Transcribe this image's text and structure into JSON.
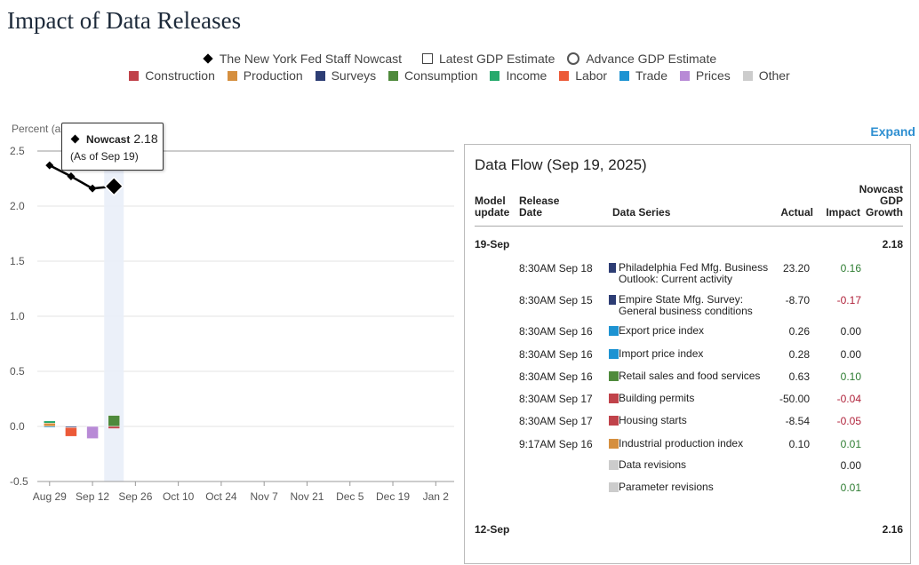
{
  "page": {
    "title": "Impact of Data Releases"
  },
  "legend": {
    "markers": [
      {
        "label": "The New York Fed Staff Nowcast",
        "icon": "filled-diamond-icon"
      },
      {
        "label": "Latest GDP Estimate",
        "icon": "open-square-icon"
      },
      {
        "label": "Advance GDP Estimate",
        "icon": "open-circle-icon"
      }
    ],
    "categories": [
      {
        "label": "Construction",
        "color": "#c0424a"
      },
      {
        "label": "Production",
        "color": "#d58f3f"
      },
      {
        "label": "Surveys",
        "color": "#2d3d74"
      },
      {
        "label": "Consumption",
        "color": "#4f8a3c"
      },
      {
        "label": "Income",
        "color": "#26a96c"
      },
      {
        "label": "Labor",
        "color": "#ec5a38"
      },
      {
        "label": "Trade",
        "color": "#1d93d2"
      },
      {
        "label": "Prices",
        "color": "#b88ad6"
      },
      {
        "label": "Other",
        "color": "#cccccc"
      }
    ]
  },
  "chart_data": {
    "type": "line",
    "ylabel": "Percent (annual rate)",
    "ylim": [
      -0.5,
      2.5
    ],
    "yticks": [
      "2.5",
      "2.0",
      "1.5",
      "1.0",
      "0.5",
      "0.0",
      "-0.5"
    ],
    "yticks_values": [
      2.5,
      2.0,
      1.5,
      1.0,
      0.5,
      0.0,
      -0.5
    ],
    "xlim": [
      "2025-08-25",
      "2026-01-08"
    ],
    "xticks": [
      {
        "label": "Aug 29",
        "date": "2025-08-29"
      },
      {
        "label": "Sep 12",
        "date": "2025-09-12"
      },
      {
        "label": "Sep 26",
        "date": "2025-09-26"
      },
      {
        "label": "Oct 10",
        "date": "2025-10-10"
      },
      {
        "label": "Oct 24",
        "date": "2025-10-24"
      },
      {
        "label": "Nov 7",
        "date": "2025-11-07"
      },
      {
        "label": "Nov 21",
        "date": "2025-11-21"
      },
      {
        "label": "Dec 5",
        "date": "2025-12-05"
      },
      {
        "label": "Dec 19",
        "date": "2025-12-19"
      },
      {
        "label": "Jan 2",
        "date": "2026-01-02"
      }
    ],
    "series": [
      {
        "name": "The New York Fed Staff Nowcast",
        "x": [
          "2025-08-29",
          "2025-09-05",
          "2025-09-12",
          "2025-09-19"
        ],
        "values": [
          2.37,
          2.27,
          2.16,
          2.18
        ]
      }
    ],
    "impact_bars": [
      {
        "date": "2025-08-29",
        "segments": [
          {
            "category": "Production",
            "value": 0.03
          },
          {
            "category": "Income",
            "value": 0.02
          },
          {
            "category": "Trade",
            "value": -0.01
          }
        ]
      },
      {
        "date": "2025-09-05",
        "segments": [
          {
            "category": "Surveys",
            "value": -0.01
          },
          {
            "category": "Labor",
            "value": -0.08
          }
        ]
      },
      {
        "date": "2025-09-12",
        "segments": [
          {
            "category": "Prices",
            "value": -0.11
          }
        ]
      },
      {
        "date": "2025-09-19",
        "segments": [
          {
            "category": "Consumption",
            "value": 0.1
          },
          {
            "category": "Construction",
            "value": -0.02
          }
        ]
      }
    ],
    "highlight_date": "2025-09-19",
    "grid": true
  },
  "tooltip": {
    "label": "Nowcast",
    "value": "2.18",
    "as_of": "(As of Sep 19)"
  },
  "expand_label": "Expand",
  "panel": {
    "title": "Data Flow (Sep 19, 2025)",
    "headers": {
      "model_update": "Model update",
      "release_date": "Release Date",
      "data_series": "Data Series",
      "actual": "Actual",
      "impact": "Impact",
      "nowcast": "Nowcast GDP Growth"
    },
    "update1": {
      "date": "19-Sep",
      "growth": "2.18"
    },
    "rows": [
      {
        "time": "8:30AM Sep 18",
        "series": "Philadelphia Fed Mfg. Business Outlook: Current activity",
        "color": "#2d3d74",
        "actual": "23.20",
        "impact": "0.16",
        "sign": "pos"
      },
      {
        "time": "8:30AM Sep 15",
        "series": "Empire State Mfg. Survey: General business conditions",
        "color": "#2d3d74",
        "actual": "-8.70",
        "impact": "-0.17",
        "sign": "neg"
      },
      {
        "time": "8:30AM Sep 16",
        "series": "Export price index",
        "color": "#1d93d2",
        "actual": "0.26",
        "impact": "0.00",
        "sign": "neu"
      },
      {
        "time": "8:30AM Sep 16",
        "series": "Import price index",
        "color": "#1d93d2",
        "actual": "0.28",
        "impact": "0.00",
        "sign": "neu"
      },
      {
        "time": "8:30AM Sep 16",
        "series": "Retail sales and food services",
        "color": "#4f8a3c",
        "actual": "0.63",
        "impact": "0.10",
        "sign": "pos"
      },
      {
        "time": "8:30AM Sep 17",
        "series": "Building permits",
        "color": "#c0424a",
        "actual": "-50.00",
        "impact": "-0.04",
        "sign": "neg"
      },
      {
        "time": "8:30AM Sep 17",
        "series": "Housing starts",
        "color": "#c0424a",
        "actual": "-8.54",
        "impact": "-0.05",
        "sign": "neg"
      },
      {
        "time": "9:17AM Sep 16",
        "series": "Industrial production index",
        "color": "#d58f3f",
        "actual": "0.10",
        "impact": "0.01",
        "sign": "pos"
      },
      {
        "time": "",
        "series": "Data revisions",
        "color": "#cccccc",
        "actual": "",
        "impact": "0.00",
        "sign": "neu"
      },
      {
        "time": "",
        "series": "Parameter revisions",
        "color": "#cccccc",
        "actual": "",
        "impact": "0.01",
        "sign": "pos"
      }
    ],
    "update2": {
      "date": "12-Sep",
      "growth": "2.16"
    }
  }
}
